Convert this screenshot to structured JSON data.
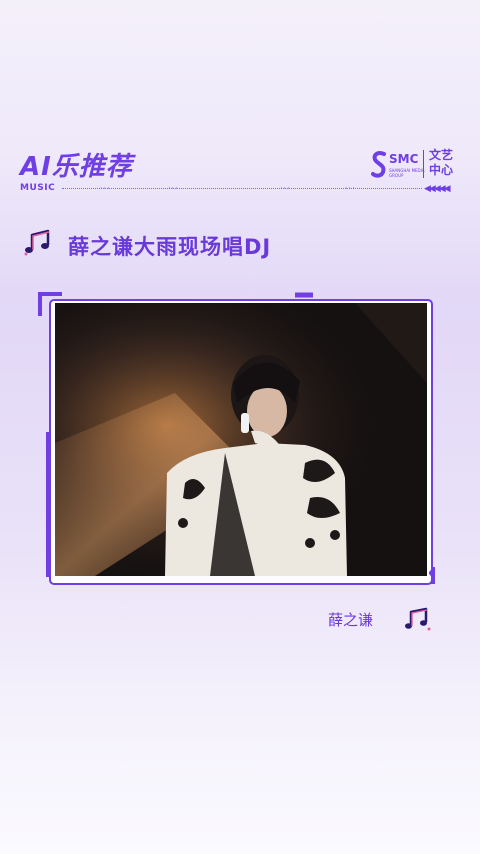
{
  "header": {
    "title": "AI乐推荐",
    "tag": "MUSIC",
    "dots": [
      "···",
      "···",
      "···",
      "···"
    ],
    "arrows": "◀◀◀◀◀"
  },
  "logo": {
    "mark": "SMC",
    "subtitle": "SHANGHAI MEDIA GROUP",
    "cn_name": "文艺中心"
  },
  "song": {
    "title": "薛之谦大雨现场唱DJ",
    "artist": "薛之谦",
    "icon": "music-note-icon"
  },
  "colors": {
    "accent": "#6f3fe3",
    "background_top": "#f4f0fa",
    "background_mid": "#e2d8f7"
  }
}
